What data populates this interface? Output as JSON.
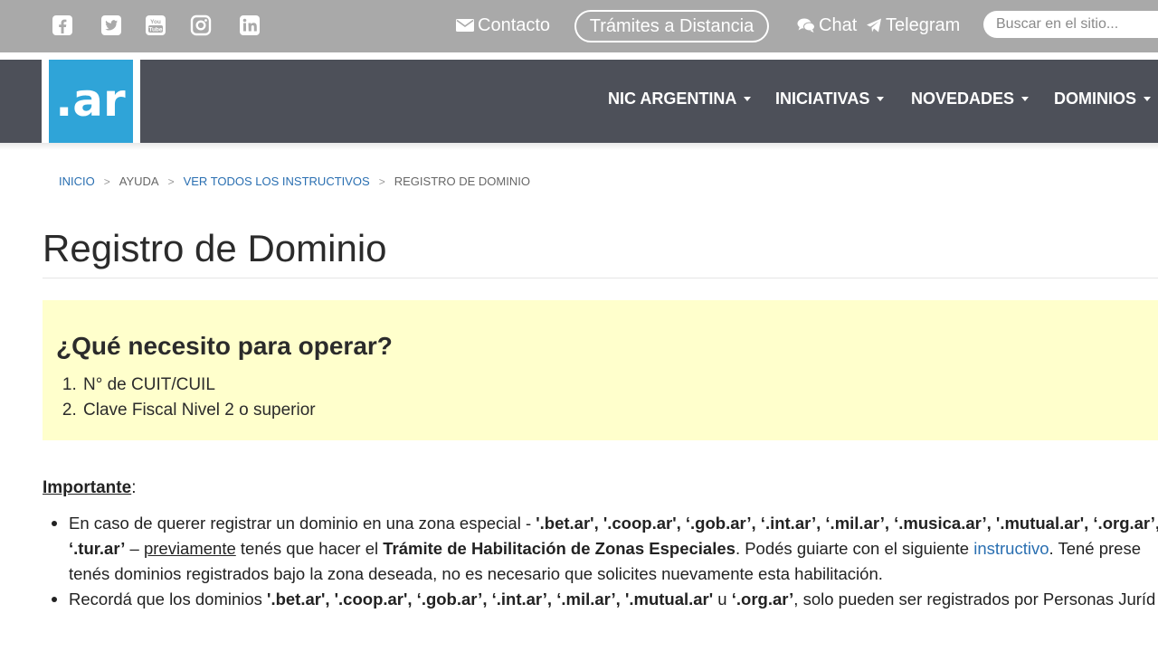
{
  "topbar": {
    "social_icons": [
      "facebook-icon",
      "twitter-icon",
      "youtube-icon",
      "instagram-icon",
      "linkedin-icon"
    ],
    "contact_label": "Contacto",
    "tramites_label": "Trámites a Distancia",
    "chat_label": "Chat",
    "telegram_label": "Telegram",
    "search_placeholder": "Buscar en el sitio..."
  },
  "nav": {
    "logo_text": ".ar",
    "items": [
      "NIC ARGENTINA",
      "INICIATIVAS",
      "NOVEDADES",
      "DOMINIOS"
    ]
  },
  "breadcrumb": {
    "inicio": "INICIO",
    "ayuda": "AYUDA",
    "instructivos": "VER TODOS LOS INSTRUCTIVOS",
    "current": "REGISTRO DE DOMINIO",
    "separator": ">"
  },
  "page": {
    "title": "Registro de Dominio"
  },
  "requirements": {
    "title": "¿Qué necesito para operar?",
    "items": [
      "N° de CUIT/CUIL",
      "Clave Fiscal Nivel 2 o superior"
    ]
  },
  "important": {
    "label": "Importante",
    "colon": ":",
    "b1_line1_prefix": "En caso de querer registrar un dominio en una zona especial - ",
    "b1_line1_zones": "'.bet.ar', '.coop.ar', ‘.gob.ar’, ‘.int.ar’, ‘.mil.ar’, ‘.musica.ar’, '.mutual.ar', ‘.org.ar’, ‘.s",
    "b1_line2_zone": "‘.tur.ar’",
    "b1_line2_dash": " – ",
    "b1_line2_previamente": "previamente",
    "b1_line2_mid": " tenés que hacer el ",
    "b1_line2_tramite": "Trámite de Habilitación de Zonas Especiales",
    "b1_line2_after": ". Podés guiarte con el siguiente ",
    "b1_line2_link": "instructivo",
    "b1_line2_end": ". Tené prese",
    "b1_line3": "tenés dominios registrados bajo la zona deseada, no es necesario que solicites nuevamente esta habilitación.",
    "b2_prefix": "Recordá que los dominios ",
    "b2_zones": "'.bet.ar', '.coop.ar', ‘.gob.ar’, ‘.int.ar’, ‘.mil.ar’, '.mutual.ar'",
    "b2_u": " u ",
    "b2_org": "‘.org.ar’",
    "b2_end": ", solo pueden ser registrados por Personas Juríd"
  },
  "colors": {
    "topbar_bg": "#a9a9a9",
    "navbar_bg": "#4d5059",
    "logo_bg": "#2fa4d8",
    "highlight_bg": "#ffffcc",
    "link": "#2a6fb1"
  }
}
